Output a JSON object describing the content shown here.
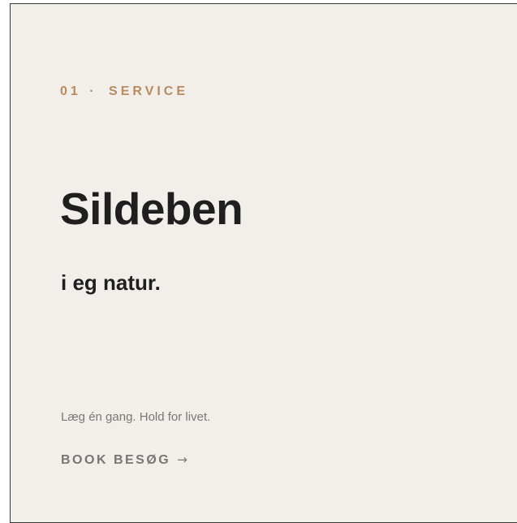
{
  "service": {
    "number": "01",
    "separator": "·",
    "label": "SERVICE"
  },
  "title": "Sildeben",
  "subtitle": "i eg natur.",
  "tagline": "Læg én gang. Hold for livet.",
  "cta": {
    "label": "BOOK BESØG",
    "arrow": "→"
  },
  "colors": {
    "background": "#f2efea",
    "accent": "#b98a5c",
    "text": "#1f1f1f",
    "muted": "#7a7775"
  },
  "icons": {
    "cta_arrow": "arrow-right-icon"
  }
}
